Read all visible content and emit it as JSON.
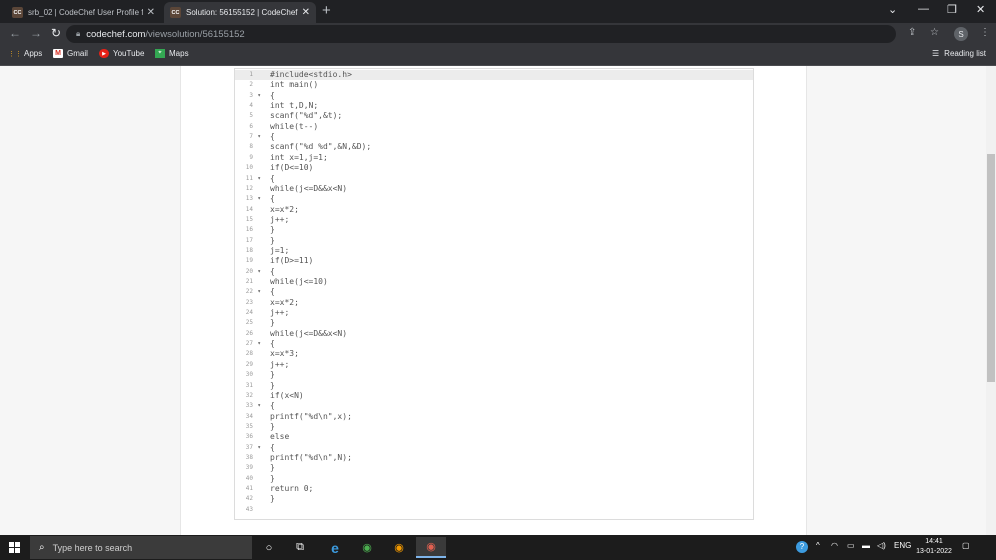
{
  "browser": {
    "tabs": [
      {
        "favicon": "CC",
        "title": "srb_02 | CodeChef User Profile fo",
        "active": false
      },
      {
        "favicon": "CC",
        "title": "Solution: 56155152 | CodeChef",
        "active": true
      }
    ],
    "new_tab": "+",
    "window_controls": {
      "minimize": "—",
      "maximize": "❐",
      "close": "✕"
    },
    "address": {
      "host": "codechef.com",
      "path": "/viewsolution/56155152"
    },
    "profile_initial": "S",
    "bookmarks": [
      {
        "icon": "apps-grid-icon",
        "label": "Apps"
      },
      {
        "icon": "gmail-icon",
        "label": "Gmail"
      },
      {
        "icon": "youtube-icon",
        "label": "YouTube"
      },
      {
        "icon": "maps-icon",
        "label": "Maps"
      }
    ],
    "reading_list": "Reading list"
  },
  "editor": {
    "lines": [
      {
        "n": "1",
        "fold": "",
        "code": "#include<stdio.h>"
      },
      {
        "n": "2",
        "fold": "",
        "code": "int main()"
      },
      {
        "n": "3",
        "fold": "▾",
        "code": "{"
      },
      {
        "n": "4",
        "fold": "",
        "code": "int t,D,N;"
      },
      {
        "n": "5",
        "fold": "",
        "code": "scanf(\"%d\",&t);"
      },
      {
        "n": "6",
        "fold": "",
        "code": "while(t--)"
      },
      {
        "n": "7",
        "fold": "▾",
        "code": "{"
      },
      {
        "n": "8",
        "fold": "",
        "code": "scanf(\"%d %d\",&N,&D);"
      },
      {
        "n": "9",
        "fold": "",
        "code": "int x=1,j=1;"
      },
      {
        "n": "10",
        "fold": "",
        "code": "if(D<=10)"
      },
      {
        "n": "11",
        "fold": "▾",
        "code": "{"
      },
      {
        "n": "12",
        "fold": "",
        "code": "while(j<=D&&x<N)"
      },
      {
        "n": "13",
        "fold": "▾",
        "code": "{"
      },
      {
        "n": "14",
        "fold": "",
        "code": "x=x*2;"
      },
      {
        "n": "15",
        "fold": "",
        "code": "j++;"
      },
      {
        "n": "16",
        "fold": "",
        "code": "}"
      },
      {
        "n": "17",
        "fold": "",
        "code": "}"
      },
      {
        "n": "18",
        "fold": "",
        "code": "j=1;"
      },
      {
        "n": "19",
        "fold": "",
        "code": "if(D>=11)"
      },
      {
        "n": "20",
        "fold": "▾",
        "code": "{"
      },
      {
        "n": "21",
        "fold": "",
        "code": "while(j<=10)"
      },
      {
        "n": "22",
        "fold": "▾",
        "code": "{"
      },
      {
        "n": "23",
        "fold": "",
        "code": "x=x*2;"
      },
      {
        "n": "24",
        "fold": "",
        "code": "j++;"
      },
      {
        "n": "25",
        "fold": "",
        "code": "}"
      },
      {
        "n": "26",
        "fold": "",
        "code": "while(j<=D&&x<N)"
      },
      {
        "n": "27",
        "fold": "▾",
        "code": "{"
      },
      {
        "n": "28",
        "fold": "",
        "code": "x=x*3;"
      },
      {
        "n": "29",
        "fold": "",
        "code": "j++;"
      },
      {
        "n": "30",
        "fold": "",
        "code": "}"
      },
      {
        "n": "31",
        "fold": "",
        "code": "}"
      },
      {
        "n": "32",
        "fold": "",
        "code": "if(x<N)"
      },
      {
        "n": "33",
        "fold": "▾",
        "code": "{"
      },
      {
        "n": "34",
        "fold": "",
        "code": "printf(\"%d\\n\",x);"
      },
      {
        "n": "35",
        "fold": "",
        "code": "}"
      },
      {
        "n": "36",
        "fold": "",
        "code": "else"
      },
      {
        "n": "37",
        "fold": "▾",
        "code": "{"
      },
      {
        "n": "38",
        "fold": "",
        "code": "printf(\"%d\\n\",N);"
      },
      {
        "n": "39",
        "fold": "",
        "code": "}"
      },
      {
        "n": "40",
        "fold": "",
        "code": "}"
      },
      {
        "n": "41",
        "fold": "",
        "code": "return 0;"
      },
      {
        "n": "42",
        "fold": "",
        "code": "}"
      },
      {
        "n": "43",
        "fold": "",
        "code": ""
      }
    ]
  },
  "taskbar": {
    "search_placeholder": "Type here to search",
    "apps": [
      {
        "name": "cortana-icon",
        "glyph": "○"
      },
      {
        "name": "task-view-icon",
        "glyph": "⧉"
      },
      {
        "name": "edge-icon",
        "glyph": "e"
      },
      {
        "name": "chrome-icon",
        "glyph": "◉"
      },
      {
        "name": "chrome-profile-icon",
        "glyph": "◉"
      },
      {
        "name": "chrome-active-icon",
        "glyph": "◉"
      }
    ],
    "language": "ENG",
    "time": "14:41",
    "date": "13-01-2022"
  },
  "colors": {
    "chrome_dark": "#202124",
    "chrome_toolbar": "#35363a",
    "taskbar": "#1c1c1c",
    "codechef_brown": "#5b4638"
  }
}
